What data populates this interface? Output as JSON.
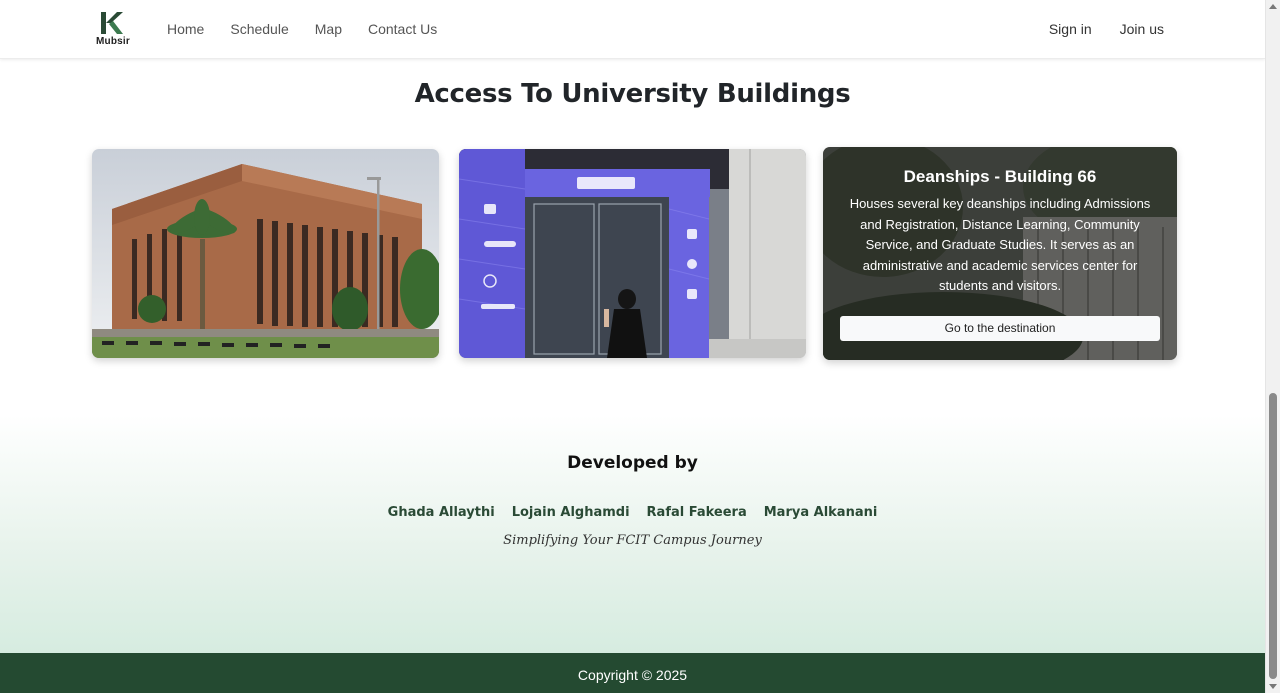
{
  "navbar": {
    "brand": "Mubsir",
    "links": [
      "Home",
      "Schedule",
      "Map",
      "Contact Us"
    ],
    "sign_in": "Sign in",
    "join_us": "Join us"
  },
  "section": {
    "title": "Access To University Buildings"
  },
  "cards": [
    {
      "image": "brick-building-photo"
    },
    {
      "image": "techhub-entrance-photo"
    },
    {
      "image": "deanships-building-photo",
      "title": "Deanships - Building 66",
      "description": "Houses several key deanships including Admissions and Registration, Distance Learning, Community Service, and Graduate Studies. It serves as an administrative and academic services center for students and visitors.",
      "button": "Go to the destination"
    }
  ],
  "developers": {
    "title": "Developed by",
    "names": [
      "Ghada Allaythi",
      "Lojain Alghamdi",
      "Rafal Fakeera",
      "Marya Alkanani"
    ],
    "tagline": "Simplifying Your FCIT Campus Journey"
  },
  "footer": {
    "copyright": "Copyright © 2025"
  },
  "colors": {
    "brand_green": "#244a31",
    "name_green": "#2a4a35"
  }
}
